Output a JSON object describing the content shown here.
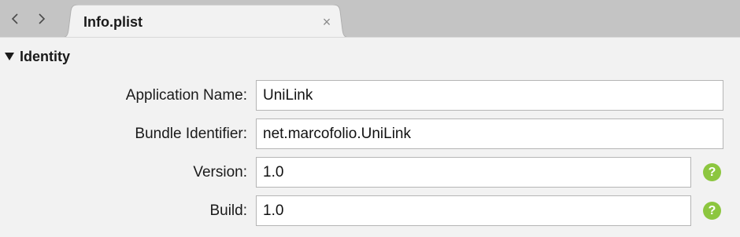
{
  "tabbar": {
    "tab": {
      "label": "Info.plist",
      "close_glyph": "×"
    },
    "nav": {
      "back_icon": "chevron-left-icon",
      "forward_icon": "chevron-right-icon"
    }
  },
  "section": {
    "title": "Identity",
    "expanded": true
  },
  "fields": {
    "application_name": {
      "label": "Application Name:",
      "value": "UniLink"
    },
    "bundle_identifier": {
      "label": "Bundle Identifier:",
      "value": "net.marcofolio.UniLink"
    },
    "version": {
      "label": "Version:",
      "value": "1.0",
      "help_glyph": "?"
    },
    "build": {
      "label": "Build:",
      "value": "1.0",
      "help_glyph": "?"
    }
  },
  "colors": {
    "tabbar_bg": "#c4c4c4",
    "content_bg": "#f2f2f2",
    "help_green": "#8cc63f"
  }
}
